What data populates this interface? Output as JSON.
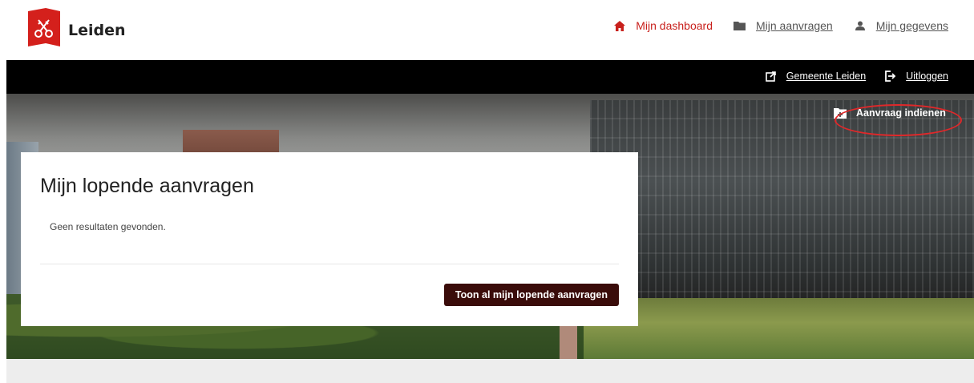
{
  "header": {
    "logo_text": "Leiden",
    "nav": [
      {
        "label": "Mijn dashboard",
        "icon": "home-icon",
        "active": true
      },
      {
        "label": "Mijn aanvragen",
        "icon": "folder-icon",
        "active": false
      },
      {
        "label": "Mijn gegevens",
        "icon": "user-icon",
        "active": false
      }
    ]
  },
  "topbar": {
    "links": [
      {
        "label": "Gemeente Leiden",
        "icon": "external-link-icon"
      },
      {
        "label": "Uitloggen",
        "icon": "logout-icon"
      }
    ]
  },
  "hero": {
    "submit_label": "Aanvraag indienen"
  },
  "card": {
    "title": "Mijn lopende aanvragen",
    "empty_text": "Geen resultaten gevonden.",
    "button_label": "Toon al mijn lopende aanvragen"
  },
  "colors": {
    "accent_red": "#c8201c",
    "button_dark": "#3a0c0a",
    "topbar": "#000000",
    "highlight": "#e0282a"
  }
}
